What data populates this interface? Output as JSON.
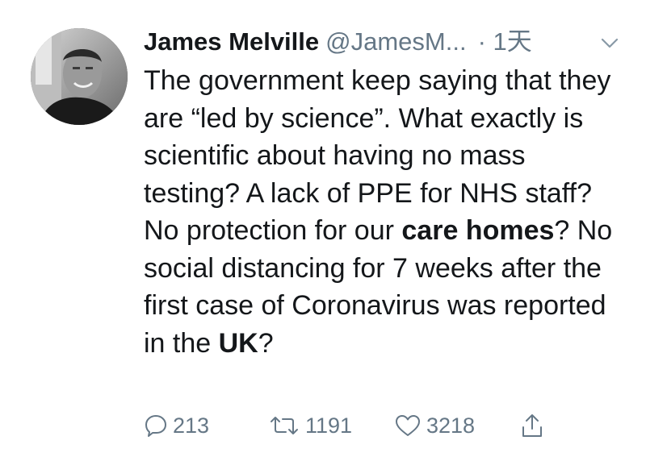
{
  "tweet": {
    "author_name": "James Melville",
    "handle": "@JamesM...",
    "time": "· 1天",
    "body": {
      "t1": "The government keep saying that they are “led by science”. What exactly is scientific about having no mass testing? A lack of PPE for NHS staff? No protection for our ",
      "b1": "care homes",
      "t2": "? No social distancing for 7 weeks after the first case of Coronavirus was reported in the ",
      "b2": "UK",
      "t3": "?"
    },
    "replies": "213",
    "retweets": "1191",
    "likes": "3218"
  },
  "icons": {
    "reply": "reply-icon",
    "retweet": "retweet-icon",
    "like": "heart-icon",
    "share": "share-icon",
    "menu": "chevron-down-icon"
  },
  "colors": {
    "text": "#14171a",
    "muted": "#657786"
  }
}
